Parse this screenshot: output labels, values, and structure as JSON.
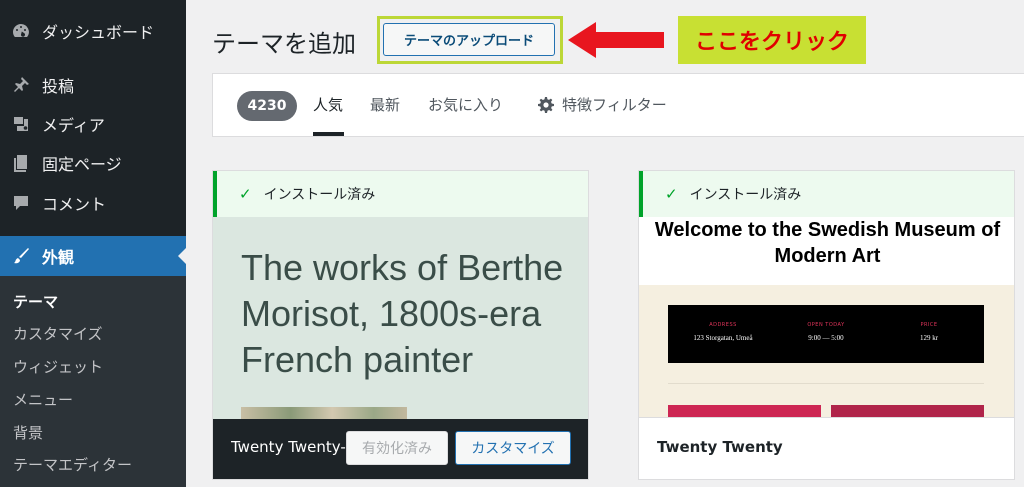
{
  "sidebar": {
    "items": [
      {
        "label": "ダッシュボード",
        "icon": "dashboard-icon"
      },
      {
        "label": "投稿",
        "icon": "pin-icon"
      },
      {
        "label": "メディア",
        "icon": "media-icon"
      },
      {
        "label": "固定ページ",
        "icon": "pages-icon"
      },
      {
        "label": "コメント",
        "icon": "comment-icon"
      },
      {
        "label": "外観",
        "icon": "brush-icon"
      }
    ],
    "submenu": [
      "テーマ",
      "カスタマイズ",
      "ウィジェット",
      "メニュー",
      "背景",
      "テーマエディター"
    ]
  },
  "header": {
    "title": "テーマを追加",
    "upload_label": "テーマのアップロード",
    "callout": "ここをクリック"
  },
  "filters": {
    "count": "4230",
    "tabs": [
      "人気",
      "最新",
      "お気に入り",
      "特徴フィルター"
    ]
  },
  "themes": [
    {
      "status": "インストール済み",
      "preview_text": "The works of Berthe Morisot, 1800s-era French painter",
      "name": "Twenty Twenty-",
      "active_label": "有効化済み",
      "customize_label": "カスタマイズ"
    },
    {
      "status": "インストール済み",
      "preview_heading": "Welcome to the Swedish Museum of Modern Art",
      "info": [
        {
          "label": "ADDRESS",
          "value": "123 Storgatan, Umeå"
        },
        {
          "label": "OPEN TODAY",
          "value": "9:00 — 5:00"
        },
        {
          "label": "PRICE",
          "value": "129 kr"
        }
      ],
      "name": "Twenty Twenty"
    }
  ],
  "colors": {
    "sidebar": "#1d2327",
    "accent": "#2271b1",
    "highlight": "#c8e033",
    "callout_text": "#e00000",
    "installed": "#00a32a"
  }
}
